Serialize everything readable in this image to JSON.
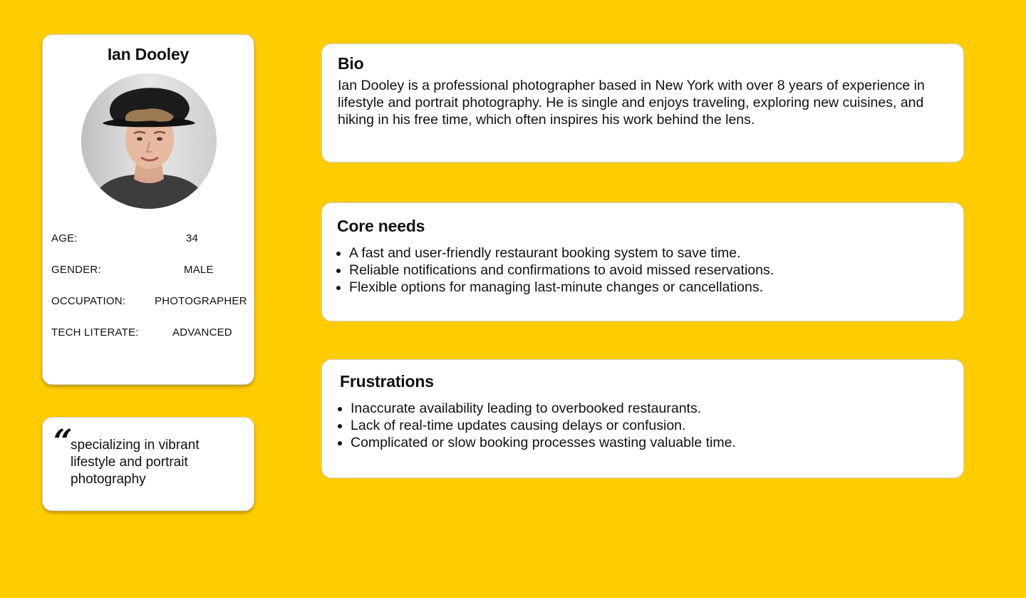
{
  "profile": {
    "name": "Ian Dooley",
    "avatar_icon": "portrait-photo",
    "attributes": [
      {
        "label": "AGE:",
        "value": "34"
      },
      {
        "label": "GENDER:",
        "value": "MALE"
      },
      {
        "label": "OCCUPATION:",
        "value": "PHOTOGRAPHER"
      },
      {
        "label": "TECH LITERATE:",
        "value": "ADVANCED"
      }
    ]
  },
  "quote": {
    "mark": "“",
    "text": "specializing in vibrant lifestyle and portrait photography"
  },
  "bio": {
    "heading": "Bio",
    "text": "Ian Dooley is a professional photographer based in New York with over 8 years of experience in lifestyle and portrait photography. He is single and enjoys traveling, exploring new cuisines, and hiking in his free time, which often inspires his work behind the lens."
  },
  "core_needs": {
    "heading": "Core needs",
    "items": [
      "A fast and user-friendly restaurant booking system to save time.",
      "Reliable notifications and confirmations to avoid missed reservations.",
      "Flexible options for managing last-minute changes or cancellations."
    ]
  },
  "frustrations": {
    "heading": "Frustrations",
    "items": [
      "Inaccurate availability leading to overbooked restaurants.",
      "Lack of real-time updates causing delays or confusion.",
      "Complicated or slow booking processes wasting valuable time."
    ]
  },
  "colors": {
    "background": "#FFCC00",
    "card": "#FFFFFF",
    "text": "#111111"
  }
}
